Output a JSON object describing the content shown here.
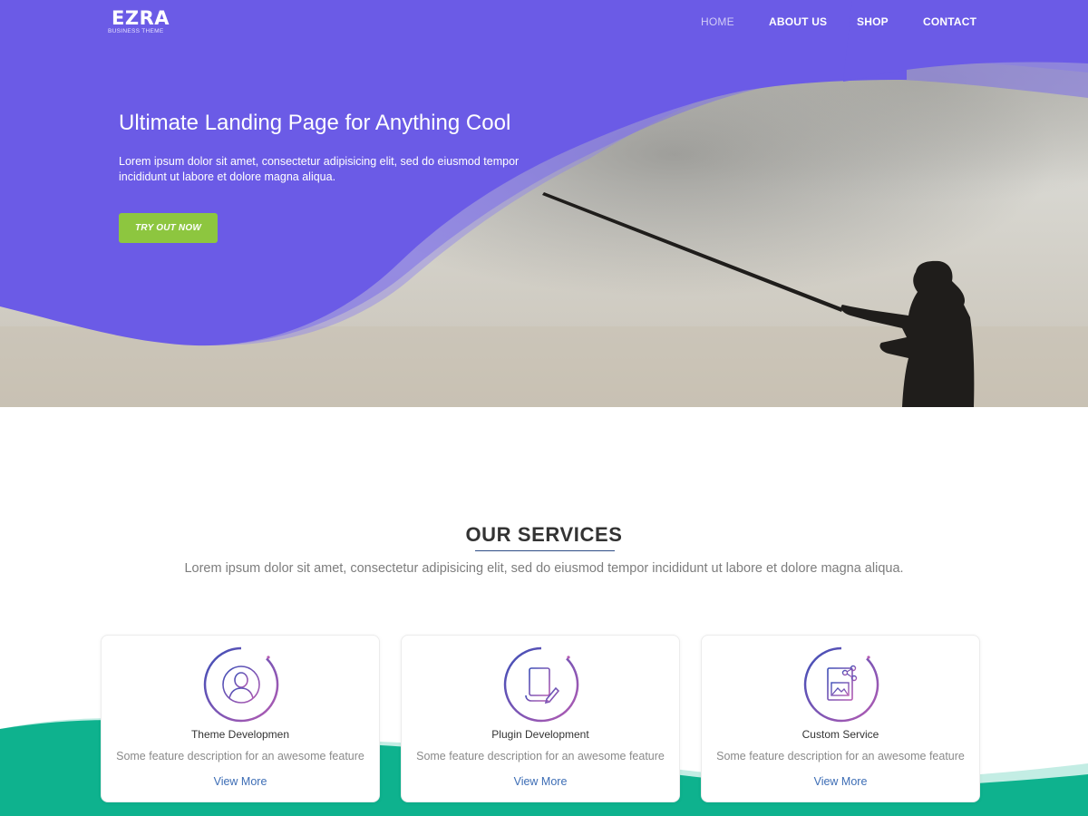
{
  "brand": {
    "name": "EZRA",
    "tagline": "BUSINESS THEME"
  },
  "nav": {
    "items": [
      {
        "label": "HOME",
        "active": true
      },
      {
        "label": "ABOUT US",
        "active": false
      },
      {
        "label": "SHOP",
        "active": false
      },
      {
        "label": "CONTACT",
        "active": false
      }
    ]
  },
  "hero": {
    "title": "Ultimate Landing Page for Anything Cool",
    "description": "Lorem ipsum dolor sit amet, consectetur adipisicing elit, sed do eiusmod tempor incididunt ut labore et dolore magna aliqua.",
    "button_label": "TRY OUT NOW"
  },
  "services": {
    "title": "OUR SERVICES",
    "description": "Lorem ipsum dolor sit amet, consectetur adipisicing elit, sed do eiusmod tempor incididunt ut labore et dolore magna aliqua.",
    "cards": [
      {
        "icon": "user-icon",
        "title": "Theme Developmen",
        "description": "Some feature description for an awesome feature",
        "link": "View More"
      },
      {
        "icon": "scroll-document-icon",
        "title": "Plugin Development",
        "description": "Some feature description for an awesome feature",
        "link": "View More"
      },
      {
        "icon": "image-file-icon",
        "title": "Custom Service",
        "description": "Some feature description for an awesome feature",
        "link": "View More"
      }
    ]
  },
  "colors": {
    "hero_purple": "#6b5be6",
    "button_green": "#8dc63f",
    "wave_teal": "#0eb28e",
    "link_blue": "#3d6db5",
    "icon_gradient_start": "#3d4fb7",
    "icon_gradient_end": "#b45bb2"
  }
}
